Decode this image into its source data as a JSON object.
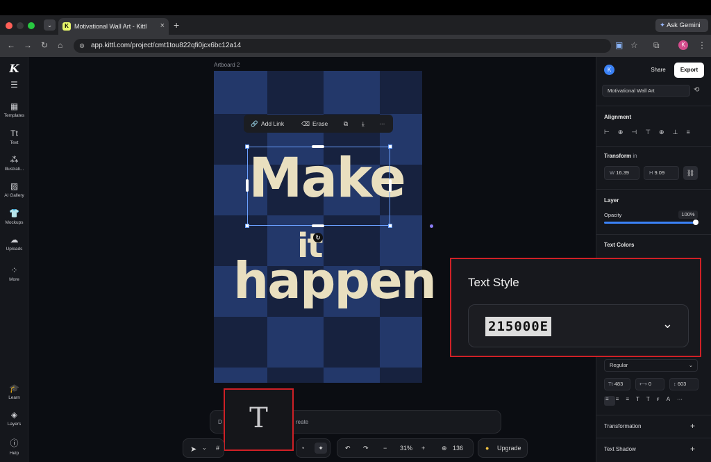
{
  "browser": {
    "tab_title": "Motivational Wall Art - Kittl",
    "tab_favicon": "K",
    "tab_close": "×",
    "new_tab": "+",
    "gemini_label": "Ask Gemini",
    "url": "app.kittl.com/project/cmt1tou822qfi0jcx6bc12a14",
    "profile_initial": "K"
  },
  "sidebar": {
    "logo": "K",
    "items": [
      {
        "label": "Templates",
        "icon": "templates-icon"
      },
      {
        "label": "Text",
        "icon": "text-icon"
      },
      {
        "label": "Illustrati...",
        "icon": "illustrations-icon"
      },
      {
        "label": "AI Gallery",
        "icon": "ai-gallery-icon"
      },
      {
        "label": "Mockups",
        "icon": "mockups-icon"
      },
      {
        "label": "Uploads",
        "icon": "uploads-icon"
      },
      {
        "label": "More",
        "icon": "more-icon"
      }
    ],
    "bottom_items": [
      {
        "label": "Learn",
        "icon": "learn-icon"
      },
      {
        "label": "Layers",
        "icon": "layers-icon"
      },
      {
        "label": "Help",
        "icon": "help-icon"
      }
    ]
  },
  "canvas": {
    "artboard_label": "Artboard 2",
    "art_words": [
      "Make",
      "it",
      "happen"
    ],
    "context_toolbar": {
      "add_link": "Add Link",
      "erase": "Erase",
      "more": "···"
    }
  },
  "right_panel": {
    "avatar_initial": "K",
    "share_label": "Share",
    "export_label": "Export",
    "project_name": "Motivational Wall Art",
    "alignment_title": "Alignment",
    "transform_title": "Transform",
    "transform_unit": "in",
    "width_label": "W",
    "width_value": "16.39",
    "height_label": "H",
    "height_value": "9.09",
    "layer_title": "Layer",
    "opacity_label": "Opacity",
    "opacity_value": "100%",
    "opacity_fraction": 1.0,
    "text_colors_title": "Text Colors",
    "font_weight": "Regular",
    "font_size": "483",
    "letter_spacing": "0",
    "line_height": "603",
    "transformation_label": "Transformation",
    "text_shadow_label": "Text Shadow",
    "add_symbol": "+"
  },
  "text_style_popup": {
    "title": "Text Style",
    "font_preview": "215000E"
  },
  "prompt_bar": {
    "left_char": "D",
    "right_text": "reate"
  },
  "text_tool_popup": {
    "glyph": "T"
  },
  "bottom_toolbar": {
    "zoom": "31%",
    "minus": "−",
    "plus": "+",
    "credits": "136",
    "upgrade": "Upgrade"
  },
  "colors": {
    "artboard_dark": "#17223f",
    "artboard_light": "#23386a",
    "art_text": "#e9dfbf",
    "highlight_red": "#cf2026",
    "accent_blue": "#3b82f6"
  }
}
